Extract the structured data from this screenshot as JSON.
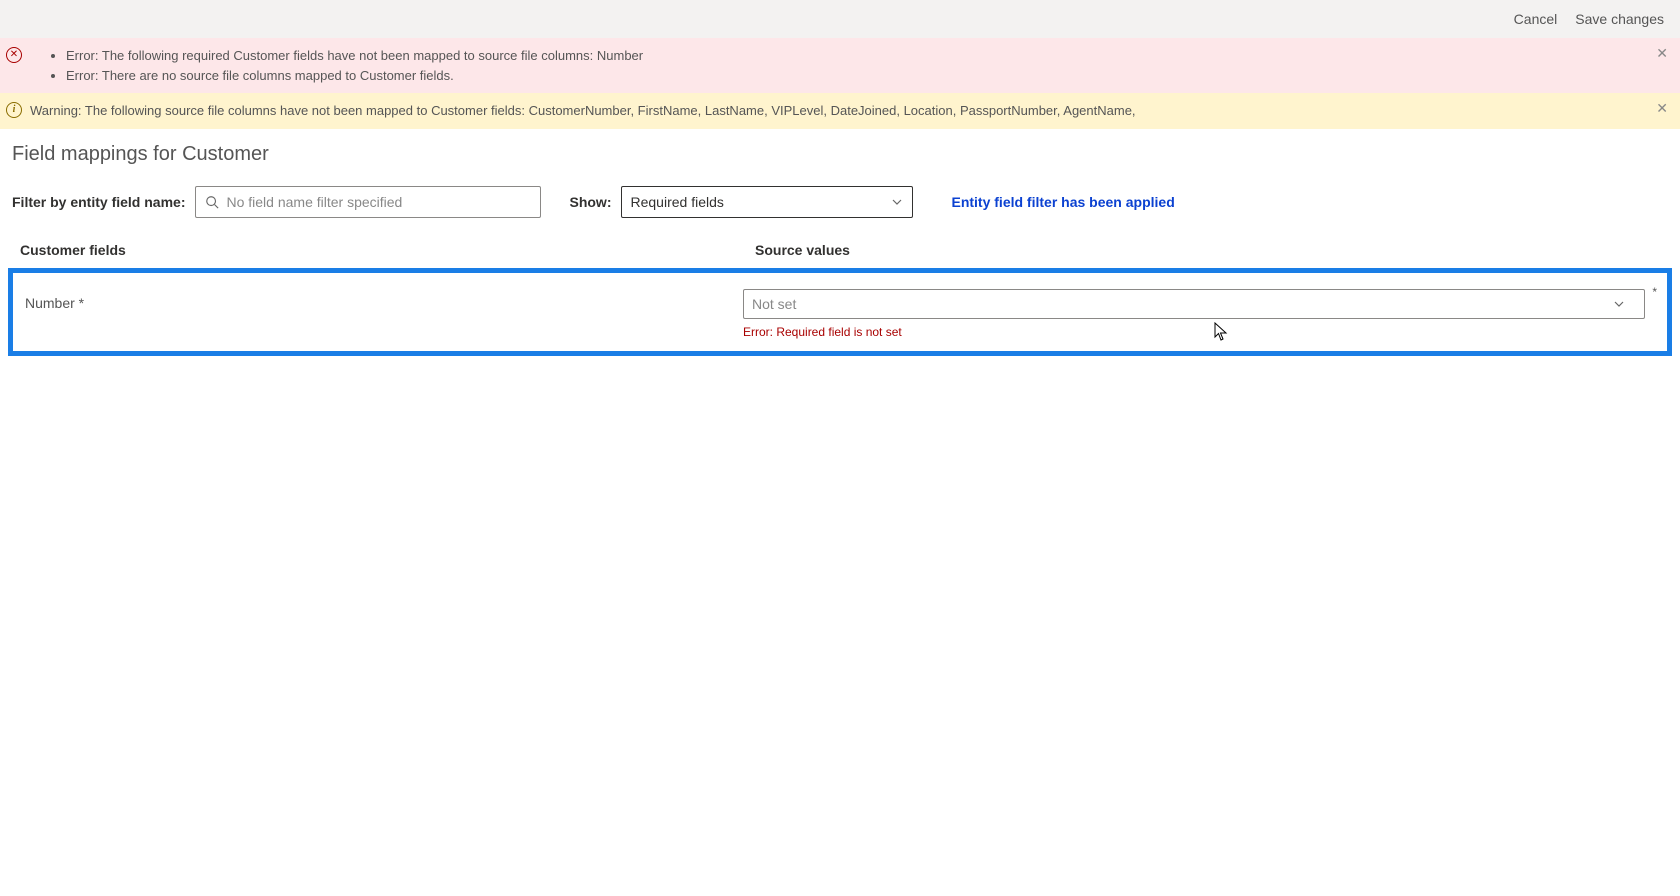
{
  "topbar": {
    "cancel": "Cancel",
    "save": "Save changes"
  },
  "error_banner": {
    "items": [
      "Error: The following required Customer fields have not been mapped to source file columns: Number",
      "Error: There are no source file columns mapped to Customer fields."
    ]
  },
  "warning_banner": {
    "msg": "Warning: The following source file columns have not been mapped to Customer fields: CustomerNumber, FirstName, LastName, VIPLevel, DateJoined, Location, PassportNumber, AgentName,"
  },
  "page_title": "Field mappings for Customer",
  "filter": {
    "label": "Filter by entity field name:",
    "placeholder": "No field name filter specified",
    "show_label": "Show:",
    "show_value": "Required fields",
    "applied_msg": "Entity field filter has been applied"
  },
  "table": {
    "col_fields": "Customer fields",
    "col_source": "Source values",
    "row": {
      "field": "Number *",
      "source_value": "Not set",
      "error": "Error: Required field is not set"
    }
  }
}
